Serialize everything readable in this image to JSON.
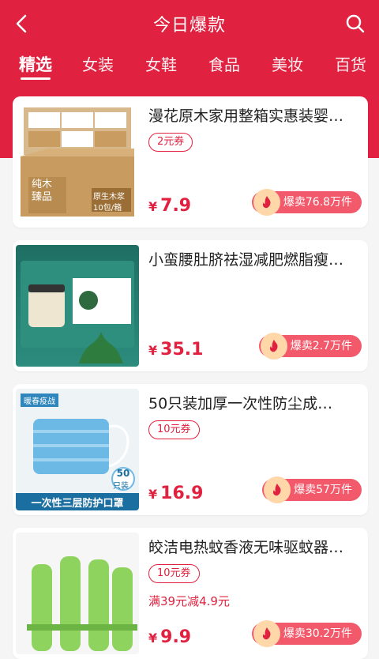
{
  "header": {
    "title": "今日爆款",
    "back_icon": "chevron-left-icon",
    "search_icon": "search-icon",
    "brand_color": "#e0213f"
  },
  "tabs": [
    {
      "label": "精选",
      "active": true
    },
    {
      "label": "女装"
    },
    {
      "label": "女鞋"
    },
    {
      "label": "食品"
    },
    {
      "label": "美妆"
    },
    {
      "label": "百货"
    }
  ],
  "products": [
    {
      "title": "漫花原木家用整箱实惠装婴…",
      "coupon": "2元券",
      "price_currency": "¥",
      "price": "7.9",
      "sales": "爆卖76.8万件",
      "image_text": {
        "a": "纯木",
        "b": "臻品",
        "c": "原生木浆",
        "d": "10包/箱"
      }
    },
    {
      "title": "小蛮腰肚脐祛湿减肥燃脂瘦…",
      "price_currency": "¥",
      "price": "35.1",
      "sales": "爆卖2.7万件"
    },
    {
      "title": "50只装加厚一次性防尘成…",
      "coupon": "10元券",
      "price_currency": "¥",
      "price": "16.9",
      "sales": "爆卖57万件",
      "image_text": {
        "a": "暖春疫战",
        "b": "50",
        "c": "只装",
        "d": "一次性三层防护口罩"
      }
    },
    {
      "title": "皎洁电热蚊香液无味驱蚊器…",
      "coupon": "10元券",
      "promo": "满39元减4.9元",
      "price_currency": "¥",
      "price": "9.9",
      "sales": "爆卖30.2万件"
    }
  ]
}
